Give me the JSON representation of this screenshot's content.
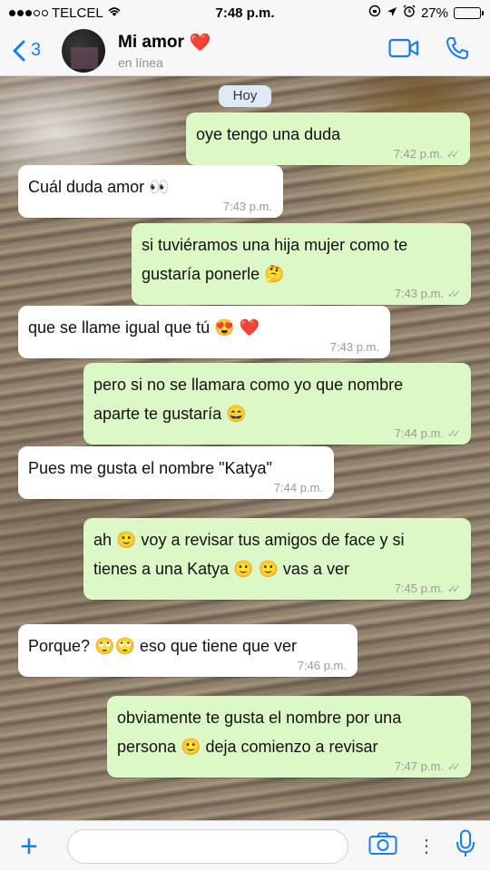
{
  "status_bar": {
    "carrier": "TELCEL",
    "time": "7:48 p.m.",
    "battery": "27%",
    "battery_level": 0.27
  },
  "header": {
    "back_count": "3",
    "contact_name": "Mi amor",
    "contact_emoji": "❤️",
    "contact_status": "en línea",
    "icons": [
      "video-call-icon",
      "phone-call-icon"
    ]
  },
  "chat": {
    "day_label": "Hoy",
    "messages": [
      {
        "dir": "out",
        "lines": [
          "oye tengo una duda"
        ],
        "time": "7:42 p.m."
      },
      {
        "dir": "in",
        "lines": [
          "Cuál duda amor 👀"
        ],
        "time": "7:43 p.m."
      },
      {
        "dir": "out",
        "lines": [
          "si tuviéramos una hija mujer como te",
          "gustaría ponerle 🤔"
        ],
        "time": "7:43 p.m."
      },
      {
        "dir": "in",
        "lines": [
          "que se llame igual que tú 😍 ❤️"
        ],
        "time": "7:43 p.m."
      },
      {
        "dir": "out",
        "lines": [
          "pero si no se llamara como yo que nombre",
          "aparte te gustaría 😄"
        ],
        "time": "7:44 p.m."
      },
      {
        "dir": "in",
        "lines": [
          "Pues me gusta el nombre \"Katya\""
        ],
        "time": "7:44 p.m."
      },
      {
        "dir": "out",
        "lines": [
          "ah 🙂  voy a revisar tus amigos de face y si",
          "tienes a una Katya 🙂 🙂  vas a ver"
        ],
        "time": "7:45 p.m."
      },
      {
        "dir": "in",
        "lines": [
          "Porque? 🙄🙄  eso que tiene que ver"
        ],
        "time": "7:46 p.m."
      },
      {
        "dir": "out",
        "lines": [
          "obviamente te gusta el nombre por una",
          "persona 🙂  deja comienzo a revisar"
        ],
        "time": "7:47 p.m."
      }
    ]
  },
  "input_bar": {
    "placeholder": "",
    "icons": [
      "plus-icon",
      "camera-icon",
      "more-icon",
      "microphone-icon"
    ]
  },
  "colors": {
    "accent": "#1a7cf5",
    "outgoing_bubble": "#dcf8c6",
    "incoming_bubble": "#ffffff",
    "battery": "#f4c20d"
  }
}
